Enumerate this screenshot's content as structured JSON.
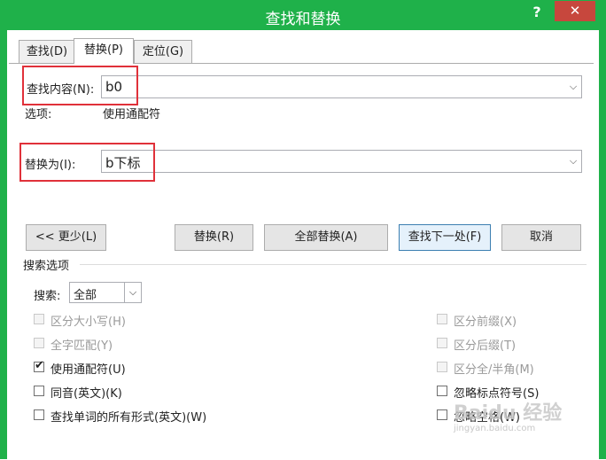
{
  "dialog": {
    "title": "查找和替换",
    "help": "?",
    "close": "✕"
  },
  "tabs": [
    {
      "label": "查找(D)"
    },
    {
      "label": "替换(P)"
    },
    {
      "label": "定位(G)"
    }
  ],
  "find": {
    "label": "查找内容(N):",
    "value": "b0",
    "options_label": "选项:",
    "options_value": "使用通配符"
  },
  "replace": {
    "label": "替换为(I):",
    "value": "b下标"
  },
  "buttons": {
    "less": "<< 更少(L)",
    "replace": "替换(R)",
    "replace_all": "全部替换(A)",
    "find_next": "查找下一处(F)",
    "cancel": "取消"
  },
  "search_options": {
    "title": "搜索选项",
    "search_label": "搜索:",
    "search_value": "全部"
  },
  "left_checks": [
    {
      "label": "区分大小写(H)"
    },
    {
      "label": "全字匹配(Y)"
    },
    {
      "label": "使用通配符(U)"
    },
    {
      "label": "同音(英文)(K)"
    },
    {
      "label": "查找单词的所有形式(英文)(W)"
    }
  ],
  "right_checks": [
    {
      "label": "区分前缀(X)"
    },
    {
      "label": "区分后缀(T)"
    },
    {
      "label": "区分全/半角(M)"
    },
    {
      "label": "忽略标点符号(S)"
    },
    {
      "label": "忽略空格(W)"
    }
  ],
  "watermark": {
    "text": "Baidu 经验",
    "url": "jingyan.baidu.com"
  },
  "colors": {
    "frame": "#1fb14a",
    "highlight": "#e0313a",
    "close": "#c7473d"
  }
}
